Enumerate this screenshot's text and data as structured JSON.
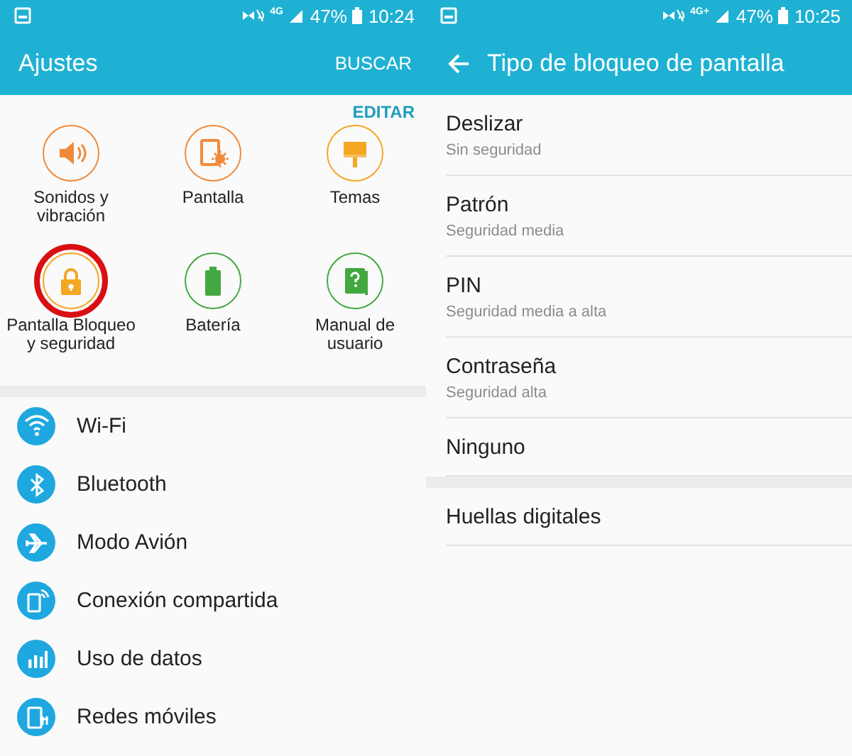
{
  "screens": [
    {
      "status_bar": {
        "network": "4G",
        "battery": "47%",
        "time": "10:24"
      },
      "toolbar": {
        "title": "Ajustes",
        "action": "BUSCAR"
      },
      "quick_settings": {
        "edit": "EDITAR",
        "tiles": [
          {
            "label": "Sonidos y vibración",
            "color": "#f08a3a",
            "highlighted": false
          },
          {
            "label": "Pantalla",
            "color": "#f08a3a",
            "highlighted": false
          },
          {
            "label": "Temas",
            "color": "#f5a623",
            "highlighted": false
          },
          {
            "label": "Pantalla Bloqueo y seguridad",
            "color": "#f5a623",
            "highlighted": true
          },
          {
            "label": "Batería",
            "color": "#43a83f",
            "highlighted": false
          },
          {
            "label": "Manual de usuario",
            "color": "#43a83f",
            "highlighted": false
          }
        ]
      },
      "settings": [
        {
          "label": "Wi-Fi"
        },
        {
          "label": "Bluetooth"
        },
        {
          "label": "Modo Avión"
        },
        {
          "label": "Conexión compartida"
        },
        {
          "label": "Uso de datos"
        },
        {
          "label": "Redes móviles"
        }
      ]
    },
    {
      "status_bar": {
        "network": "4G+",
        "battery": "47%",
        "time": "10:25"
      },
      "toolbar": {
        "title": "Tipo de bloqueo de pantalla"
      },
      "sections": [
        [
          {
            "title": "Deslizar",
            "subtitle": "Sin seguridad"
          },
          {
            "title": "Patrón",
            "subtitle": "Seguridad media"
          },
          {
            "title": "PIN",
            "subtitle": "Seguridad media a alta"
          },
          {
            "title": "Contraseña",
            "subtitle": "Seguridad alta"
          },
          {
            "title": "Ninguno"
          }
        ],
        [
          {
            "title": "Huellas digitales"
          }
        ]
      ]
    }
  ]
}
